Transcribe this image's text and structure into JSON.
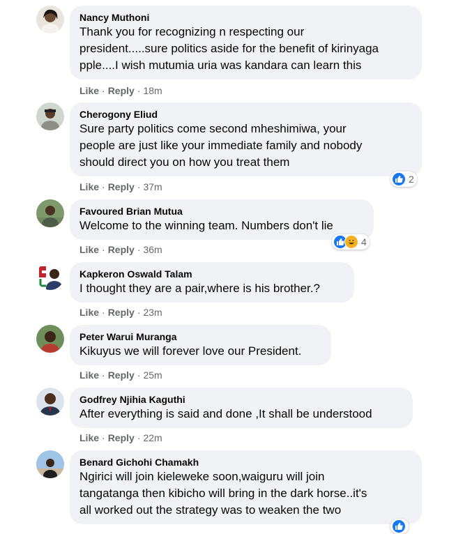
{
  "comments": [
    {
      "author": "Nancy Muthoni",
      "text": "Thank you for recognizing n respecting our\npresident.....sure politics aside for the benefit of kirinyaga\npple....I wish mutumia uria was kandara can learn this",
      "like": "Like",
      "reply": "Reply",
      "time": "18m"
    },
    {
      "author": "Cherogony Eliud",
      "text": "Sure party politics come second mheshimiwa, your\npeople are just like your immediate family and nobody\nshould direct you on how you treat them",
      "like": "Like",
      "reply": "Reply",
      "time": "37m",
      "reaction_count": "2"
    },
    {
      "author": "Favoured Brian Mutua",
      "text": "Welcome to the winning team. Numbers don't lie",
      "like": "Like",
      "reply": "Reply",
      "time": "36m",
      "reaction_count": "4"
    },
    {
      "author": "Kapkeron Oswald Talam",
      "text": "I thought they are a pair,where is his brother.?",
      "like": "Like",
      "reply": "Reply",
      "time": "23m"
    },
    {
      "author": "Peter Warui Muranga",
      "text": "Kikuyus we will forever love our President.",
      "like": "Like",
      "reply": "Reply",
      "time": "25m"
    },
    {
      "author": "Godfrey Njihia Kaguthi",
      "text": "After everything is said and done ,It shall be understood",
      "like": "Like",
      "reply": "Reply",
      "time": "22m"
    },
    {
      "author": "Benard Gichohi Chamakh",
      "text": "Ngirici will join kieleweke soon,waiguru will join\ntangatanga then kibicho will bring in the dark horse..it's\nall worked out the strategy was to weaken the two"
    }
  ],
  "colors": {
    "bubble": "#f0f2f5",
    "like_blue": "#1877f2",
    "haha_yellow": "#f7b125",
    "meta_grey": "#65676b"
  },
  "icons": [
    "like-reaction-icon",
    "haha-reaction-icon"
  ]
}
